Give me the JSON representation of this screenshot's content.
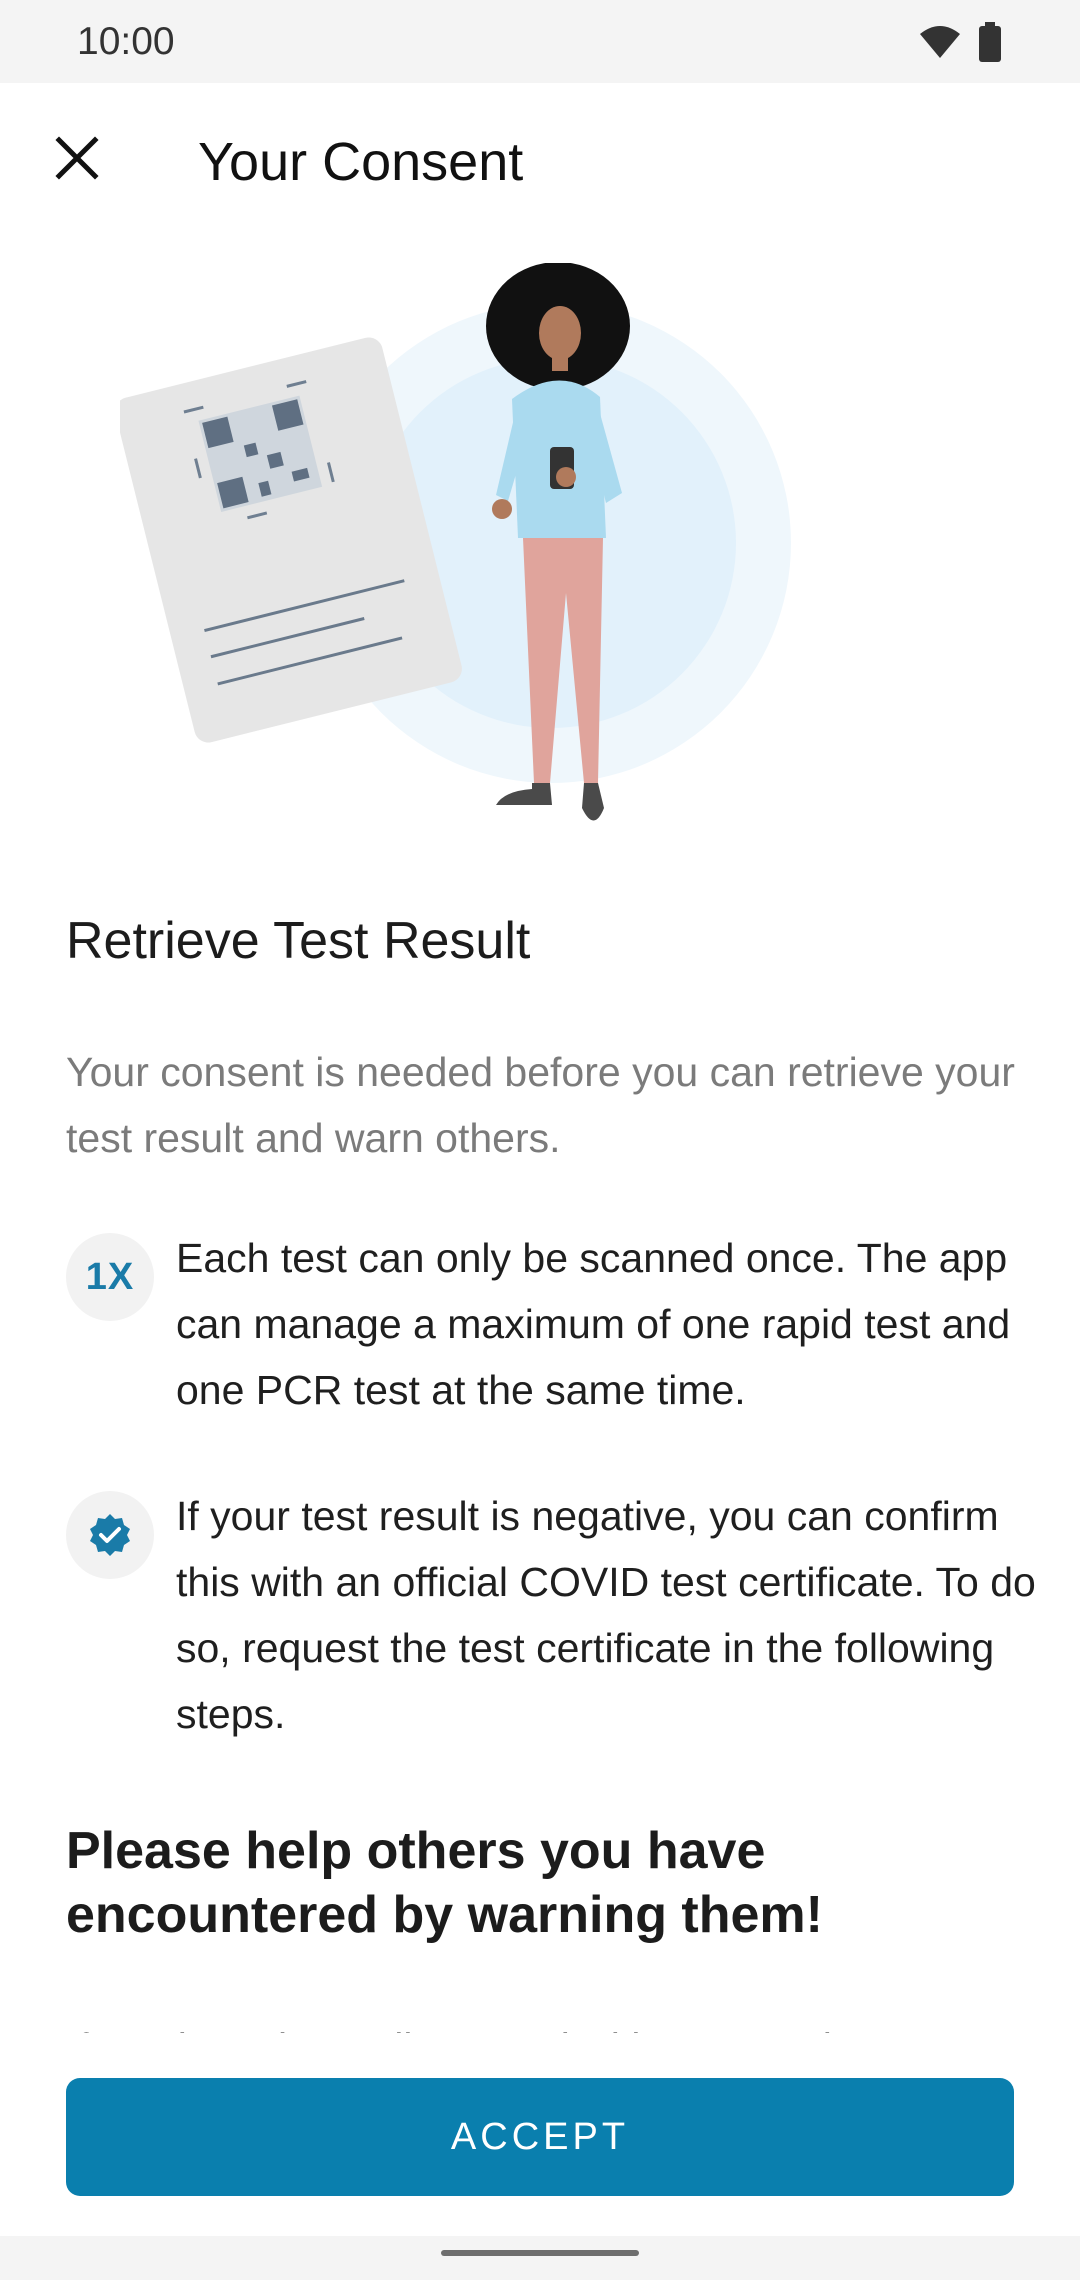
{
  "status_bar": {
    "time": "10:00",
    "wifi_icon": "wifi-icon",
    "battery_icon": "battery-icon"
  },
  "app_bar": {
    "title": "Your Consent",
    "close_icon": "close-icon"
  },
  "content": {
    "section_title": "Retrieve Test Result",
    "intro": "Your consent is needed before you can retrieve your test result and warn others.",
    "bullets": [
      {
        "icon_label": "1X",
        "icon": "once-icon",
        "text": "Each test can only be scanned once. The app can manage a maximum of one rapid test and one PCR test at the same time."
      },
      {
        "icon": "verified-badge-icon",
        "text": "If your test result is negative, you can confirm this with an official COVID test certificate. To do so, request the test certificate in the following steps."
      }
    ],
    "help_title": "Please help others you have encountered by warning them!",
    "cut_off_text": "If you have been diagnosed with corona virus"
  },
  "accept_button": {
    "label": "ACCEPT"
  },
  "colors": {
    "accent": "#0a7fae",
    "status_bar_bg": "#f4f4f4",
    "muted_text": "#7b7b7b"
  }
}
